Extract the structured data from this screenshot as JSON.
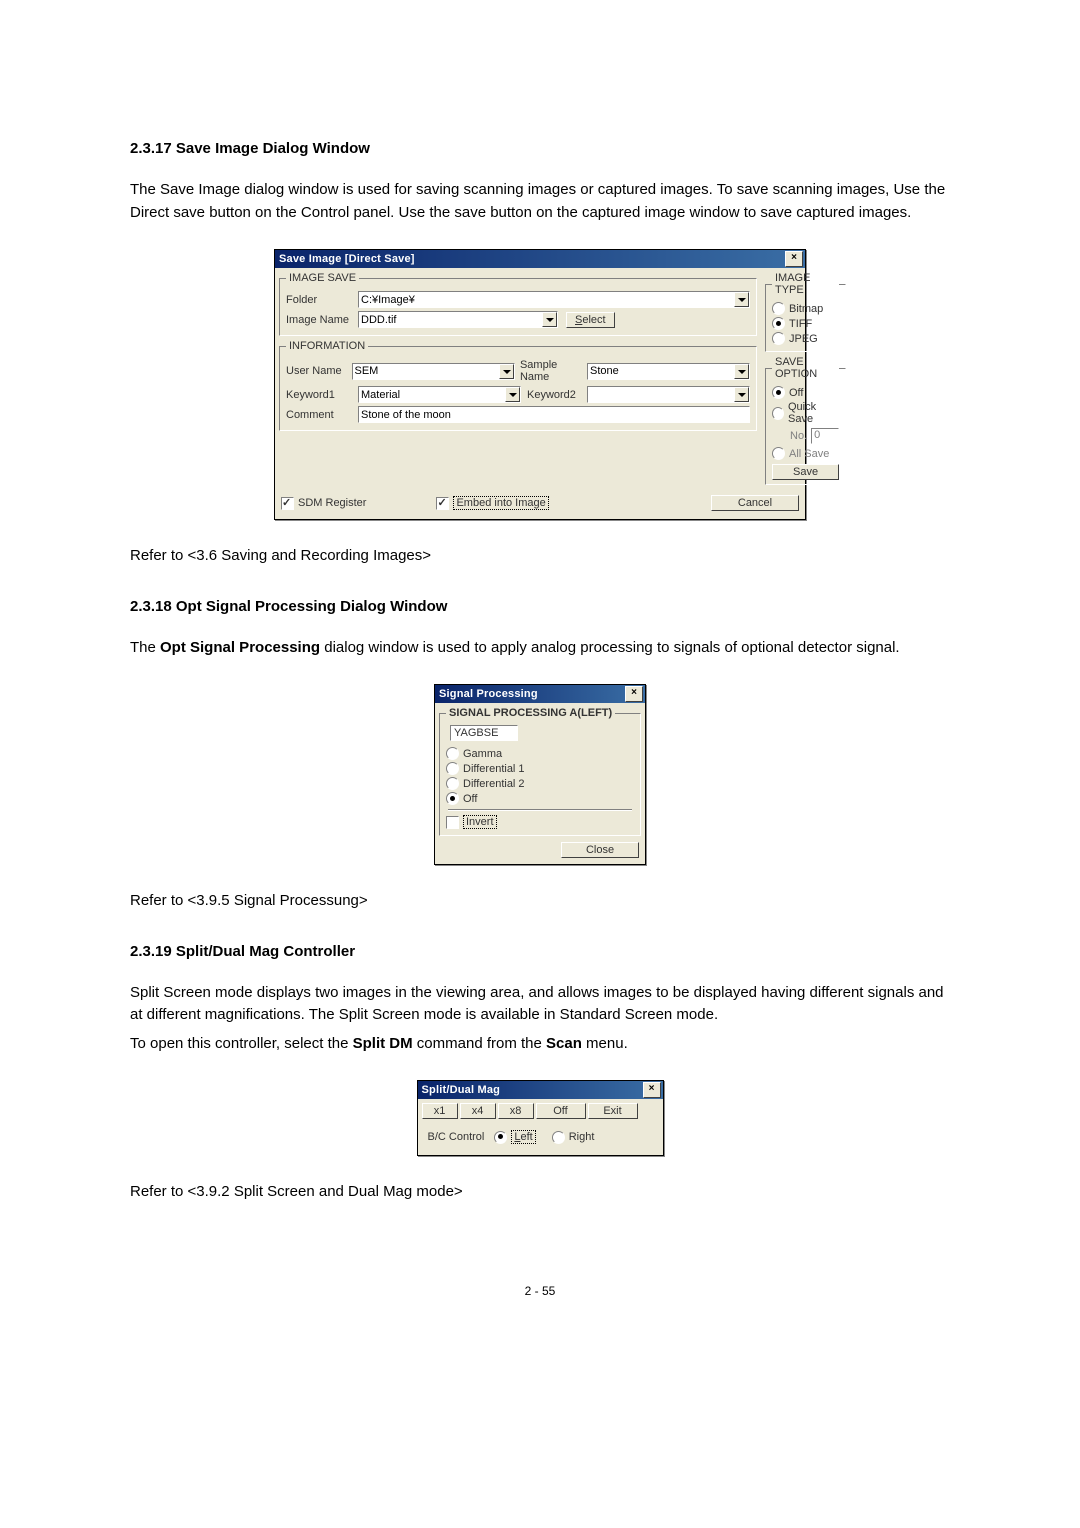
{
  "sections": {
    "s1": {
      "heading": "2.3.17   Save Image Dialog Window",
      "para": "The Save Image dialog window is used for saving scanning images or captured images. To save scanning images, Use the Direct save button on the Control panel. Use the save button on the captured image window to save captured images.",
      "ref": "Refer to <3.6 Saving and Recording Images>"
    },
    "s2": {
      "heading": "2.3.18   Opt Signal Processing Dialog Window",
      "para_pre": "The ",
      "para_bold": "Opt Signal Processing",
      "para_post": " dialog window is used to apply analog processing to signals of optional detector signal.",
      "ref": "Refer to <3.9.5 Signal Processung>"
    },
    "s3": {
      "heading": "2.3.19   Split/Dual Mag Controller",
      "para1": "Split Screen mode displays two images in the viewing area, and allows images to be displayed having different signals and at different magnifications. The Split Screen mode is available in Standard Screen mode.",
      "para2_pre": "To open this controller, select the ",
      "para2_b1": "Split DM",
      "para2_mid": " command from the ",
      "para2_b2": "Scan",
      "para2_post": " menu.",
      "ref": "Refer to <3.9.2 Split Screen and Dual Mag mode>"
    }
  },
  "dlg1": {
    "title": "Save Image [Direct Save]",
    "image_save_legend": "IMAGE SAVE",
    "folder_label": "Folder",
    "folder_value": "C:¥Image¥",
    "imagename_label": "Image Name",
    "imagename_value": "DDD.tif",
    "select_btn_pre": "S",
    "select_btn_rest": "elect",
    "info_legend": "INFORMATION",
    "username_label": "User Name",
    "username_value": "SEM",
    "samplename_label": "Sample Name",
    "samplename_value": "Stone",
    "keyword1_label": "Keyword1",
    "keyword1_value": "Material",
    "keyword2_label": "Keyword2",
    "keyword2_value": "",
    "comment_label": "Comment",
    "comment_value": "Stone of the moon",
    "imagetype_legend": "IMAGE TYPE",
    "it_bitmap": "Bitmap",
    "it_tiff": "TIFF",
    "it_jpeg": "JPEG",
    "saveoption_legend": "SAVE OPTION",
    "so_off": "Off",
    "so_quick": "Quick Save",
    "so_no": "No.",
    "so_no_val": "0",
    "so_allsave": "All Save",
    "save_btn": "Save",
    "sdm_reg": "SDM Register",
    "embed": "Embed into Image",
    "cancel_btn": "Cancel"
  },
  "dlg2": {
    "title": "Signal Processing",
    "legend": "SIGNAL PROCESSING A(LEFT)",
    "signal": "YAGBSE",
    "gamma": "Gamma",
    "diff1": "Differential 1",
    "diff2": "Differential 2",
    "off": "Off",
    "invert": "Invert",
    "close": "Close"
  },
  "dlg3": {
    "title": "Split/Dual Mag",
    "x1": "x1",
    "x4": "x4",
    "x8": "x8",
    "off": "Off",
    "exit": "Exit",
    "bc": "B/C Control",
    "left_pre": "L",
    "left_rest": "eft",
    "right": "Right"
  },
  "pagenum": "2 - 55"
}
